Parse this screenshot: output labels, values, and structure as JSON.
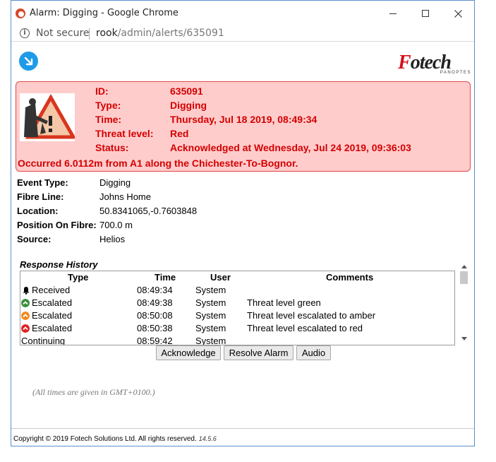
{
  "window": {
    "title": "Alarm: Digging - Google Chrome",
    "controls": {
      "minimize": "minimize-icon",
      "maximize": "maximize-icon",
      "close": "close-icon"
    }
  },
  "address_bar": {
    "security_label": "Not secure",
    "url_host": "rook",
    "url_path": "/admin/alerts/635091"
  },
  "logo": {
    "text_f": "F",
    "text_rest": "otech",
    "sub": "PANOPTES"
  },
  "alarm": {
    "rows": [
      {
        "label": "ID:",
        "value": "635091"
      },
      {
        "label": "Type:",
        "value": "Digging"
      },
      {
        "label": "Time:",
        "value": "Thursday, Jul 18 2019, 08:49:34"
      },
      {
        "label": "Threat level:",
        "value": "Red"
      },
      {
        "label": "Status:",
        "value": "Acknowledged at Wednesday, Jul 24 2019, 09:36:03"
      }
    ],
    "occurred": "Occurred 6.0112m from A1 along the Chichester-To-Bognor.",
    "colors": {
      "background": "#ffcccc",
      "border": "#e34848",
      "text": "#d40000"
    }
  },
  "details": [
    {
      "label": "Event Type:",
      "value": "Digging"
    },
    {
      "label": "Fibre Line:",
      "value": "Johns Home"
    },
    {
      "label": "Location:",
      "value": "50.8341065,-0.7603848"
    },
    {
      "label": "Position On Fibre:",
      "value": "700.0 m"
    },
    {
      "label": "Source:",
      "value": "Helios"
    }
  ],
  "response_history": {
    "title": "Response History",
    "columns": [
      "Type",
      "Time",
      "User",
      "Comments"
    ],
    "rows": [
      {
        "icon": "bell-icon",
        "icon_color": "#000000",
        "type": "Received",
        "time": "08:49:34",
        "user": "System",
        "comment": ""
      },
      {
        "icon": "chevron-up-circle-icon",
        "icon_color": "#3a8f3a",
        "type": "Escalated",
        "time": "08:49:38",
        "user": "System",
        "comment": "Threat level green"
      },
      {
        "icon": "chevron-up-circle-icon",
        "icon_color": "#f08a1c",
        "type": "Escalated",
        "time": "08:50:08",
        "user": "System",
        "comment": "Threat level escalated to amber"
      },
      {
        "icon": "chevron-up-circle-icon",
        "icon_color": "#e02222",
        "type": "Escalated",
        "time": "08:50:38",
        "user": "System",
        "comment": "Threat level escalated to red"
      },
      {
        "icon": "",
        "icon_color": "",
        "type": "Continuing",
        "time": "08:59:42",
        "user": "System",
        "comment": ""
      }
    ]
  },
  "buttons": {
    "acknowledge": "Acknowledge",
    "resolve": "Resolve Alarm",
    "audio": "Audio"
  },
  "timezone_note": "(All times are given in GMT+0100.)",
  "footer": {
    "copyright": "Copyright © 2019 Fotech Solutions Ltd. All rights reserved.",
    "version": "14.5.6"
  }
}
